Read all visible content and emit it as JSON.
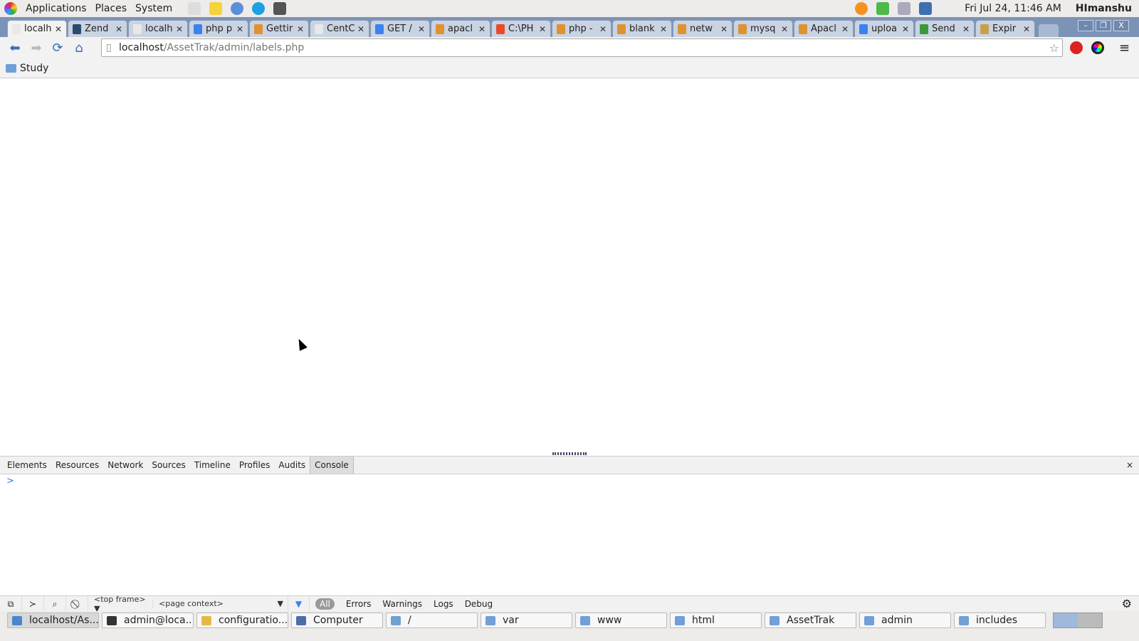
{
  "panel": {
    "menus": [
      "Applications",
      "Places",
      "System"
    ],
    "launchers": [
      "mail-clock-icon",
      "notes-icon",
      "chromium-icon",
      "skype-icon",
      "calculator-icon"
    ],
    "tray": [
      "update-icon",
      "check-icon",
      "volume-icon",
      "network-icon"
    ],
    "clock": "Fri Jul 24, 11:46 AM",
    "user": "HImanshu"
  },
  "tabs": [
    {
      "label": "localh",
      "icon": "page-icon",
      "color": "#e8e8e8"
    },
    {
      "label": "Zend",
      "icon": "zend-icon",
      "color": "#2b4c6f"
    },
    {
      "label": "localh",
      "icon": "page-icon",
      "color": "#e8e8e8"
    },
    {
      "label": "php p",
      "icon": "google-icon",
      "color": "#3b82f0"
    },
    {
      "label": "Gettir",
      "icon": "stackoverflow-icon",
      "color": "#e0922f"
    },
    {
      "label": "CentC",
      "icon": "page-icon",
      "color": "#e8e8e8"
    },
    {
      "label": "GET /",
      "icon": "google-icon",
      "color": "#3b82f0"
    },
    {
      "label": "apacl",
      "icon": "stackoverflow-icon",
      "color": "#e0922f"
    },
    {
      "label": "C:\\PH",
      "icon": "windows-icon",
      "color": "#e94b2a"
    },
    {
      "label": "php -",
      "icon": "stackoverflow-icon",
      "color": "#e0922f"
    },
    {
      "label": "blank",
      "icon": "stackoverflow-icon",
      "color": "#e0922f"
    },
    {
      "label": "netw",
      "icon": "stackoverflow-icon",
      "color": "#e0922f"
    },
    {
      "label": "mysq",
      "icon": "stackoverflow-icon",
      "color": "#e0922f"
    },
    {
      "label": "Apacl",
      "icon": "stackoverflow-icon",
      "color": "#e0922f"
    },
    {
      "label": "uploa",
      "icon": "google-icon",
      "color": "#3b82f0"
    },
    {
      "label": "Send",
      "icon": "send-icon",
      "color": "#3a9a3a"
    },
    {
      "label": "Expir",
      "icon": "package-icon",
      "color": "#c9a04a"
    }
  ],
  "address": {
    "host": "localhost",
    "path": "/AssetTrak/admin/labels.php"
  },
  "bookmarks": [
    {
      "label": "Study"
    }
  ],
  "devtools": {
    "tabs": [
      "Elements",
      "Resources",
      "Network",
      "Sources",
      "Timeline",
      "Profiles",
      "Audits",
      "Console"
    ],
    "selected": "Console",
    "prompt": ">",
    "frame": "<top frame>",
    "context": "<page context>",
    "filter_all": "All",
    "levels": [
      "Errors",
      "Warnings",
      "Logs",
      "Debug"
    ]
  },
  "taskbar": [
    {
      "label": "localhost/As...",
      "active": true,
      "color": "#4a86d0"
    },
    {
      "label": "admin@loca...",
      "color": "#333"
    },
    {
      "label": "configuratio...",
      "color": "#e6b84a"
    },
    {
      "label": "Computer",
      "color": "#4a6ea8"
    },
    {
      "label": "/",
      "color": "#6fa0d6"
    },
    {
      "label": "var",
      "color": "#6fa0d6"
    },
    {
      "label": "www",
      "color": "#6fa0d6"
    },
    {
      "label": "html",
      "color": "#6fa0d6"
    },
    {
      "label": "AssetTrak",
      "color": "#6fa0d6"
    },
    {
      "label": "admin",
      "color": "#6fa0d6"
    },
    {
      "label": "includes",
      "color": "#6fa0d6"
    }
  ]
}
